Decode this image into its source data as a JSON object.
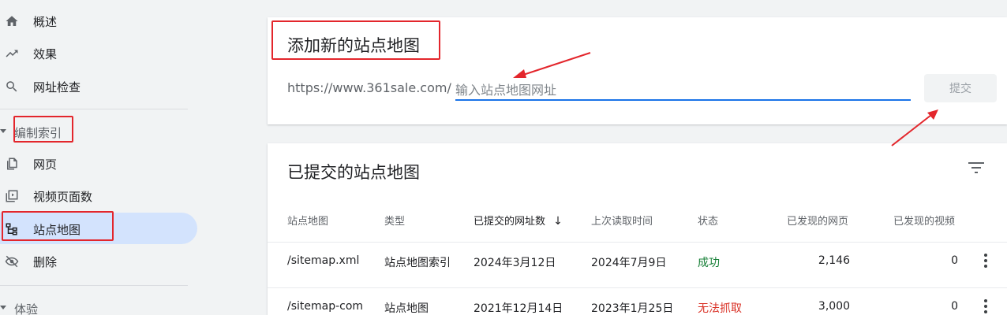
{
  "sidebar": {
    "items": [
      {
        "label": "概述",
        "icon": "home-icon"
      },
      {
        "label": "效果",
        "icon": "trending-up-icon"
      },
      {
        "label": "网址检查",
        "icon": "search-icon"
      }
    ],
    "section_index": "编制索引",
    "index_items": [
      {
        "label": "网页",
        "icon": "pages-icon"
      },
      {
        "label": "视频页面数",
        "icon": "video-pages-icon"
      },
      {
        "label": "站点地图",
        "icon": "sitemap-icon",
        "active": true
      },
      {
        "label": "删除",
        "icon": "visibility-off-icon"
      }
    ],
    "section_experience": "体验"
  },
  "add_sitemap": {
    "title": "添加新的站点地图",
    "prefix": "https://www.361sale.com/",
    "placeholder": "输入站点地图网址",
    "submit_label": "提交"
  },
  "submitted": {
    "title": "已提交的站点地图",
    "columns": [
      "站点地图",
      "类型",
      "已提交的网址数",
      "上次读取时间",
      "状态",
      "已发现的网页",
      "已发现的视频"
    ],
    "sort_indicator": "↓",
    "rows": [
      {
        "sitemap": "/sitemap.xml",
        "type": "站点地图索引",
        "submitted": "2024年3月12日",
        "last_read": "2024年7月9日",
        "status": "成功",
        "status_kind": "ok",
        "pages": "2,146",
        "videos": "0"
      },
      {
        "sitemap": "/sitemap-com",
        "type": "站点地图",
        "submitted": "2021年12月14日",
        "last_read": "2023年1月25日",
        "status": "无法抓取",
        "status_kind": "error",
        "pages": "3,000",
        "videos": "0"
      }
    ]
  },
  "colors": {
    "accent": "#1a73e8",
    "active_nav": "#d3e3fd",
    "success": "#188038",
    "error": "#d93025",
    "annotation": "#e3262c"
  }
}
